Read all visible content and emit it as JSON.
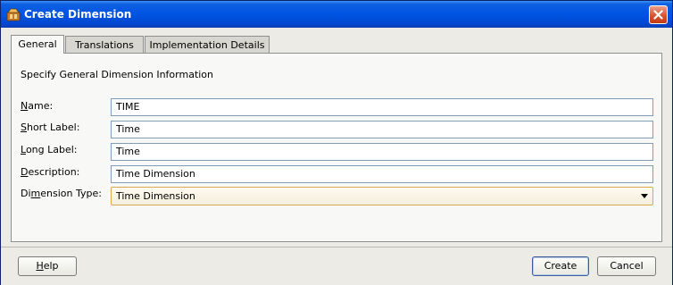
{
  "window": {
    "title": "Create Dimension"
  },
  "tabs": [
    {
      "label": "General"
    },
    {
      "label": "Translations"
    },
    {
      "label": "Implementation Details"
    }
  ],
  "section_heading": "Specify General Dimension Information",
  "form": {
    "name": {
      "label_mn": "N",
      "label_rest": "ame:",
      "value": "TIME"
    },
    "short_label": {
      "label_mn": "S",
      "label_rest": "hort Label:",
      "value": "Time"
    },
    "long_label": {
      "label_mn": "L",
      "label_rest": "ong Label:",
      "value": "Time"
    },
    "description": {
      "label_mn": "D",
      "label_rest": "escription:",
      "value": "Time Dimension"
    },
    "dimension_type": {
      "label_pre": "Di",
      "label_mn": "m",
      "label_rest": "ension Type:",
      "value": "Time Dimension"
    }
  },
  "buttons": {
    "help_mn": "H",
    "help_rest": "elp",
    "create": "Create",
    "cancel": "Cancel"
  }
}
